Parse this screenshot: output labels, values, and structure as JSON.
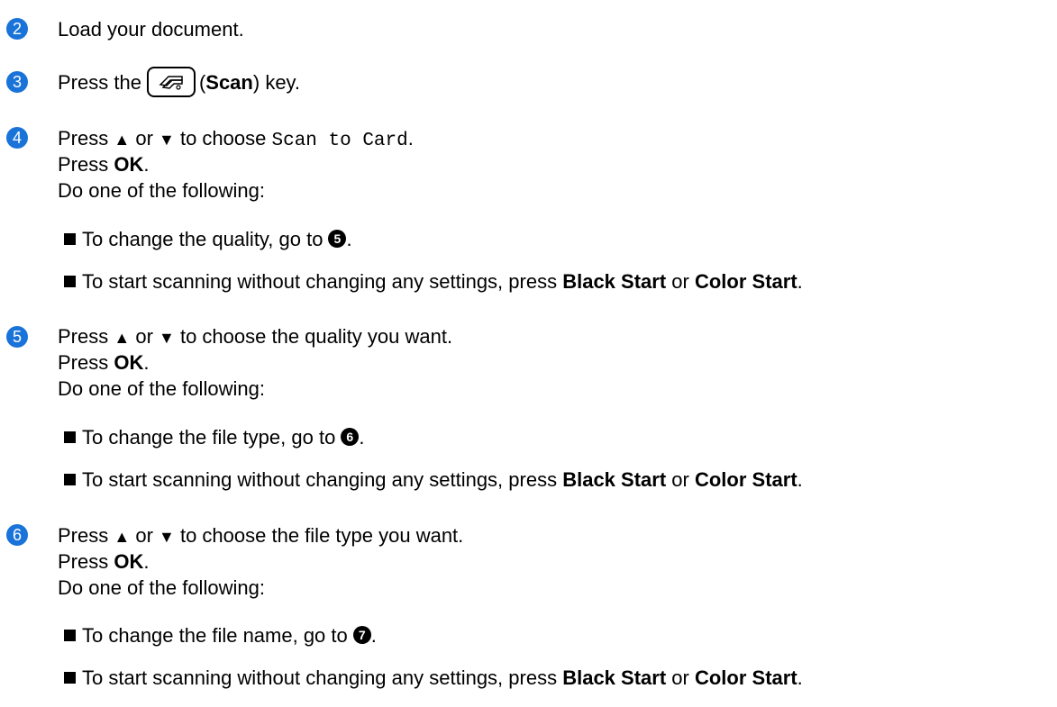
{
  "accent_color": "#1a73d8",
  "steps": [
    {
      "num": "2",
      "lines": [
        "Load your document."
      ]
    },
    {
      "num": "3",
      "prefix": "Press the",
      "key_name": "Scan",
      "suffix": "key."
    },
    {
      "num": "4",
      "lines": [
        "Press",
        "or",
        "to choose",
        "Scan to Card",
        ".",
        "Press",
        "OK",
        ".",
        "Do one of the following:"
      ],
      "bullets": [
        {
          "text": "To change the quality, go to",
          "ref": "5",
          "end": "."
        },
        {
          "text": "To start scanning without changing any settings, press",
          "b1": "Black Start",
          "or": "or",
          "b2": "Color Start",
          "end": "."
        }
      ]
    },
    {
      "num": "5",
      "lines": [
        "Press",
        "or",
        "to choose the quality you want.",
        "Press",
        "OK",
        ".",
        "Do one of the following:"
      ],
      "bullets": [
        {
          "text": "To change the file type, go to",
          "ref": "6",
          "end": "."
        },
        {
          "text": "To start scanning without changing any settings, press",
          "b1": "Black Start",
          "or": "or",
          "b2": "Color Start",
          "end": "."
        }
      ]
    },
    {
      "num": "6",
      "lines": [
        "Press",
        "or",
        "to choose the file type you want.",
        "Press",
        "OK",
        ".",
        "Do one of the following:"
      ],
      "bullets": [
        {
          "text": "To change the file name, go to",
          "ref": "7",
          "end": "."
        },
        {
          "text": "To start scanning without changing any settings, press",
          "b1": "Black Start",
          "or": "or",
          "b2": "Color Start",
          "end": "."
        }
      ]
    }
  ]
}
